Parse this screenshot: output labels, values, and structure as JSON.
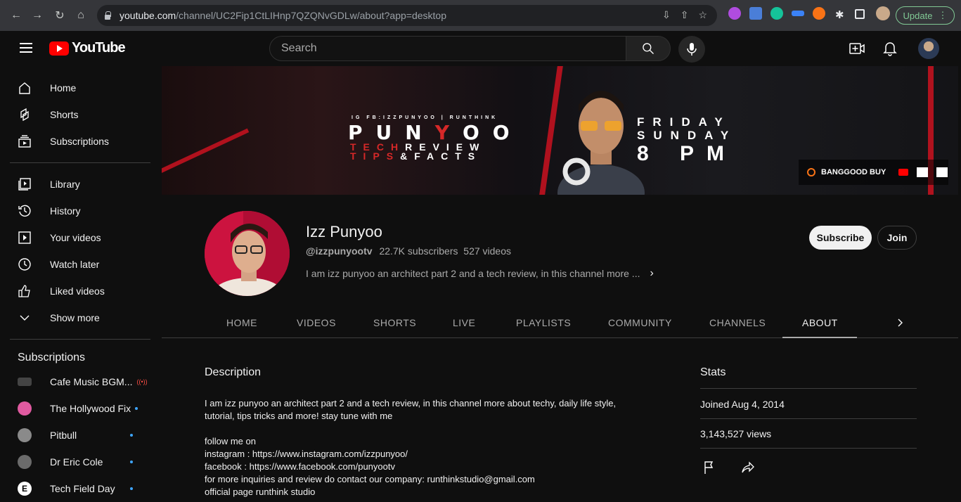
{
  "browser": {
    "url_host": "youtube.com",
    "url_path": "/channel/UC2Fip1CtLIHnp7QZQNvGDLw/about?app=desktop",
    "update_label": "Update"
  },
  "header": {
    "logo_text": "YouTube",
    "search_placeholder": "Search"
  },
  "sidebar": {
    "primary": [
      {
        "label": "Home",
        "icon": "home-icon"
      },
      {
        "label": "Shorts",
        "icon": "shorts-icon"
      },
      {
        "label": "Subscriptions",
        "icon": "subscriptions-icon"
      }
    ],
    "secondary": [
      {
        "label": "Library",
        "icon": "library-icon"
      },
      {
        "label": "History",
        "icon": "history-icon"
      },
      {
        "label": "Your videos",
        "icon": "your-videos-icon"
      },
      {
        "label": "Watch later",
        "icon": "watch-later-icon"
      },
      {
        "label": "Liked videos",
        "icon": "liked-videos-icon"
      },
      {
        "label": "Show more",
        "icon": "chevron-down-icon"
      }
    ],
    "subscriptions_title": "Subscriptions",
    "subscriptions": [
      {
        "label": "Cafe Music BGM...",
        "color": "#444444",
        "live": true
      },
      {
        "label": "The Hollywood Fix",
        "color": "#e05aa0",
        "live": false
      },
      {
        "label": "Pitbull",
        "color": "#8a8a8a",
        "live": false
      },
      {
        "label": "Dr Eric Cole",
        "color": "#6b6b6b",
        "live": false
      },
      {
        "label": "Tech Field Day",
        "color": "#ffffff",
        "live": false
      }
    ]
  },
  "banner": {
    "handle_line": "IG FB:IZZPUNYOO | RUNTHINK",
    "name_white": "PUN",
    "name_red": "Y",
    "name_white2": "OO",
    "line1_red": "TECH",
    "line1_white": "REVIEW",
    "line2_red": "TIPS",
    "line2_white": "&FACTS",
    "day1": "FRIDAY",
    "day2": "SUNDAY",
    "time": "8 PM",
    "sponsor": "BANGGOOD BUY"
  },
  "channel": {
    "name": "Izz Punyoo",
    "handle": "@izzpunyootv",
    "subscribers": "22.7K subscribers",
    "videos": "527 videos",
    "short_description": "I am izz punyoo an architect part 2 and a tech review, in this channel more ...",
    "subscribe_label": "Subscribe",
    "join_label": "Join"
  },
  "tabs": [
    "HOME",
    "VIDEOS",
    "SHORTS",
    "LIVE",
    "PLAYLISTS",
    "COMMUNITY",
    "CHANNELS",
    "ABOUT"
  ],
  "active_tab": "ABOUT",
  "about": {
    "description_title": "Description",
    "description_lines": [
      "I am izz punyoo an architect part 2 and a tech review, in this channel more about techy, daily life style,",
      "tutorial, tips tricks and more! stay tune with me",
      "",
      "follow me on",
      "instagram :  https://www.instagram.com/izzpunyoo/",
      "facebook : https://www.facebook.com/punyootv",
      "for more inquiries and review do contact our company: runthinkstudio@gmail.com",
      "official page runthink studio"
    ],
    "stats_title": "Stats",
    "joined": "Joined Aug 4, 2014",
    "views": "3,143,527 views"
  }
}
